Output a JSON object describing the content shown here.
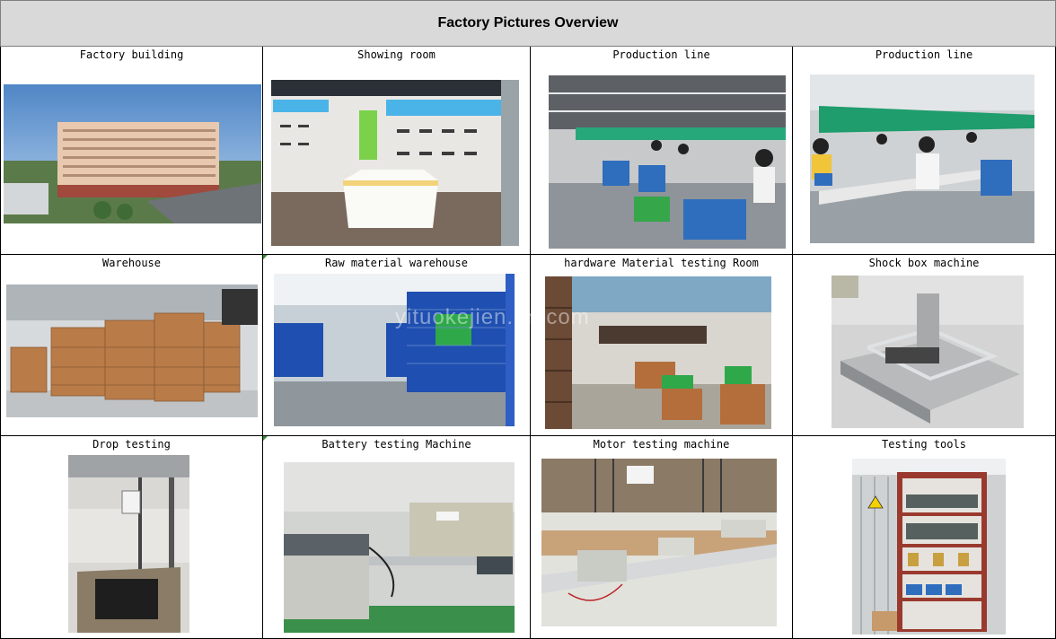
{
  "title": "Factory Pictures Overview",
  "watermark": "yituokejien.en.com",
  "rows": [
    [
      {
        "caption": "Factory building",
        "icon": "factory-building-photo"
      },
      {
        "caption": "Showing room",
        "icon": "showroom-photo"
      },
      {
        "caption": "Production line",
        "icon": "production-line-photo"
      },
      {
        "caption": "Production line",
        "icon": "production-line-photo"
      }
    ],
    [
      {
        "caption": "Warehouse",
        "icon": "warehouse-photo"
      },
      {
        "caption": "Raw material warehouse",
        "icon": "raw-material-warehouse-photo"
      },
      {
        "caption": "hardware Material testing Room",
        "icon": "testing-room-photo"
      },
      {
        "caption": "Shock box machine",
        "icon": "shock-box-photo"
      }
    ],
    [
      {
        "caption": "Drop testing",
        "icon": "drop-testing-photo"
      },
      {
        "caption": "Battery testing Machine",
        "icon": "battery-tester-photo"
      },
      {
        "caption": "Motor testing machine",
        "icon": "motor-tester-photo"
      },
      {
        "caption": "Testing tools",
        "icon": "testing-tools-photo"
      }
    ]
  ]
}
